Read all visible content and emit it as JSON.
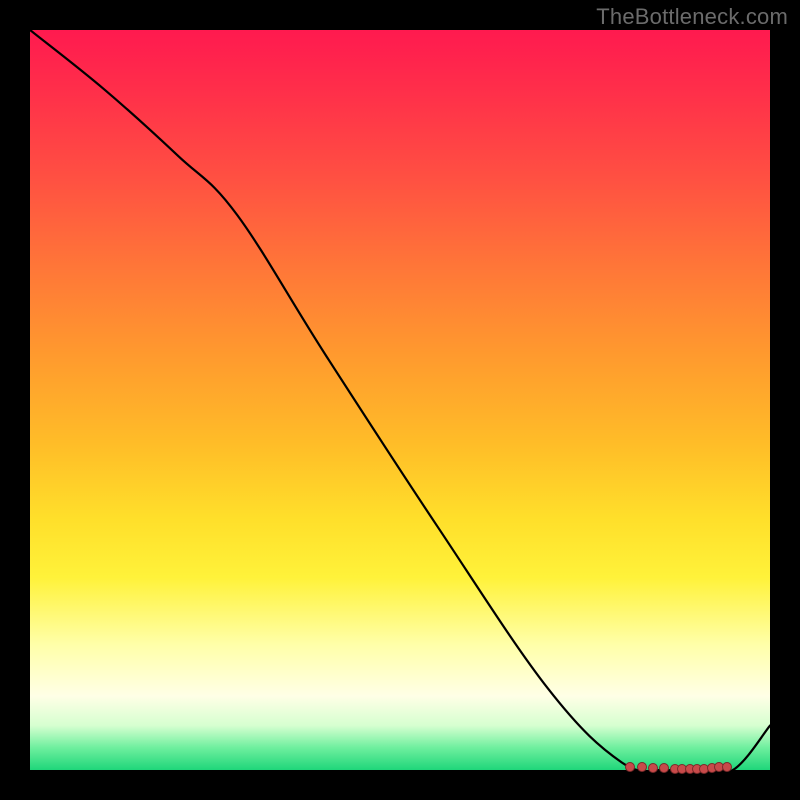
{
  "watermark": "TheBottleneck.com",
  "chart_data": {
    "type": "line",
    "title": "",
    "xlabel": "",
    "ylabel": "",
    "xlim": [
      0,
      100
    ],
    "ylim": [
      0,
      100
    ],
    "grid": false,
    "series": [
      {
        "name": "curve",
        "x": [
          0,
          10,
          20,
          28,
          40,
          55,
          70,
          80,
          86,
          90,
          95,
          100
        ],
        "y": [
          100,
          92,
          83,
          75,
          56,
          33,
          11,
          1,
          0,
          0,
          0,
          6
        ]
      }
    ],
    "markers": {
      "name": "optimal-region",
      "x": [
        81,
        82.5,
        84,
        85.5,
        87,
        88,
        89,
        90,
        91,
        92,
        93,
        94
      ],
      "y": [
        0.6,
        0.5,
        0.4,
        0.4,
        0.3,
        0.3,
        0.3,
        0.3,
        0.3,
        0.4,
        0.5,
        0.6
      ]
    },
    "background_gradient": {
      "stops": [
        {
          "pos": 0,
          "color": "#ff1a4f"
        },
        {
          "pos": 20,
          "color": "#ff5042"
        },
        {
          "pos": 44,
          "color": "#ff9a2e"
        },
        {
          "pos": 66,
          "color": "#ffdf2a"
        },
        {
          "pos": 83,
          "color": "#ffffa8"
        },
        {
          "pos": 94,
          "color": "#d6ffd0"
        },
        {
          "pos": 100,
          "color": "#1fd67a"
        }
      ]
    }
  }
}
